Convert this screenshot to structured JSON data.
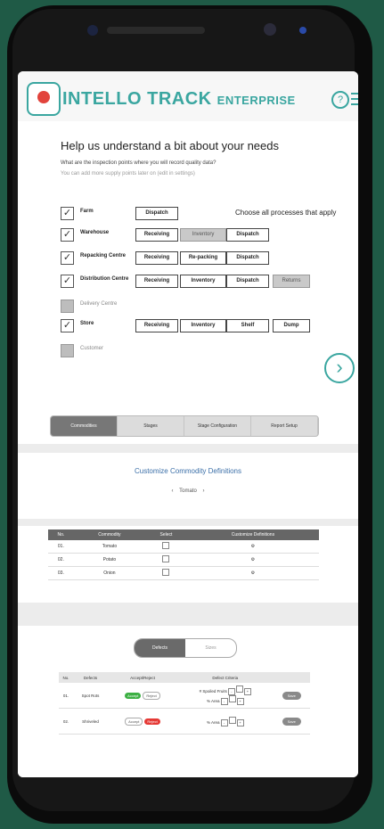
{
  "header": {
    "brand": "INTELLO TRACK",
    "brand_sub": "ENTERPRISE",
    "help_icon": "?",
    "menu_icon": "hamburger-menu"
  },
  "intro": {
    "title": "Help us understand a bit about your needs",
    "question": "What are the inspection points where you will record quality data?",
    "note": "You can add more supply points later on (edit in settings)",
    "choose_label": "Choose all processes that apply"
  },
  "processes": [
    {
      "label": "Farm",
      "checked": true,
      "check": "✓",
      "buttons": [
        {
          "label": "Dispatch",
          "grey": false
        }
      ]
    },
    {
      "label": "Warehouse",
      "checked": true,
      "check": "✓",
      "buttons": [
        {
          "label": "Receiving",
          "grey": false
        },
        {
          "label": "Inventory",
          "grey": true
        },
        {
          "label": "Dispatch",
          "grey": false
        }
      ]
    },
    {
      "label": "Repacking Centre",
      "checked": true,
      "check": "✓",
      "buttons": [
        {
          "label": "Receiving",
          "grey": false
        },
        {
          "label": "Re-packing",
          "grey": false
        },
        {
          "label": "Dispatch",
          "grey": false
        }
      ]
    },
    {
      "label": "Distribution Centre",
      "checked": true,
      "check": "✓",
      "buttons": [
        {
          "label": "Receiving",
          "grey": false
        },
        {
          "label": "Inventory",
          "grey": false
        },
        {
          "label": "Dispatch",
          "grey": false
        },
        {
          "label": "Returns",
          "grey": true
        }
      ]
    },
    {
      "label": "Delivery Centre",
      "checked": false,
      "check": "",
      "buttons": []
    },
    {
      "label": "Store",
      "checked": true,
      "check": "✓",
      "buttons": [
        {
          "label": "Receiving",
          "grey": false
        },
        {
          "label": "Inventory",
          "grey": false
        },
        {
          "label": "Shelf",
          "grey": false
        },
        {
          "label": "Dump",
          "grey": false
        }
      ]
    },
    {
      "label": "Customer",
      "checked": false,
      "check": "",
      "buttons": []
    }
  ],
  "next_button": "›",
  "tabs": [
    {
      "label": "Commodities",
      "active": true
    },
    {
      "label": "Stages",
      "active": false
    },
    {
      "label": "Stage Configuration",
      "active": false
    },
    {
      "label": "Report Setup",
      "active": false
    }
  ],
  "commodity": {
    "title": "Customize Commodity Definitions",
    "prev": "‹",
    "current": "Tomato",
    "next": "›",
    "headers": [
      "No.",
      "Commodity",
      "Select",
      "Customize Definitions"
    ],
    "rows": [
      {
        "no": "01.",
        "name": "Tomato",
        "gear": "⚙"
      },
      {
        "no": "02.",
        "name": "Potato",
        "gear": "⚙"
      },
      {
        "no": "03.",
        "name": "Onion",
        "gear": "⚙"
      }
    ]
  },
  "defects_toggle": {
    "left": "Defects",
    "right": "Sizes"
  },
  "defects": {
    "headers": [
      "No.",
      "Defects",
      "Accept/Reject",
      "Defect Criteria",
      ""
    ],
    "rows": [
      {
        "no": "01.",
        "name": "Spot Rots",
        "accept": "Accept",
        "reject": "Reject",
        "accept_active": true,
        "criteria": [
          "# Spoiled Fruits",
          "% Area"
        ],
        "save": "Save"
      },
      {
        "no": "02.",
        "name": "Shriveled",
        "accept": "Accept",
        "reject": "Reject",
        "accept_active": false,
        "criteria": [
          "% Area"
        ],
        "save": "Save"
      }
    ]
  }
}
